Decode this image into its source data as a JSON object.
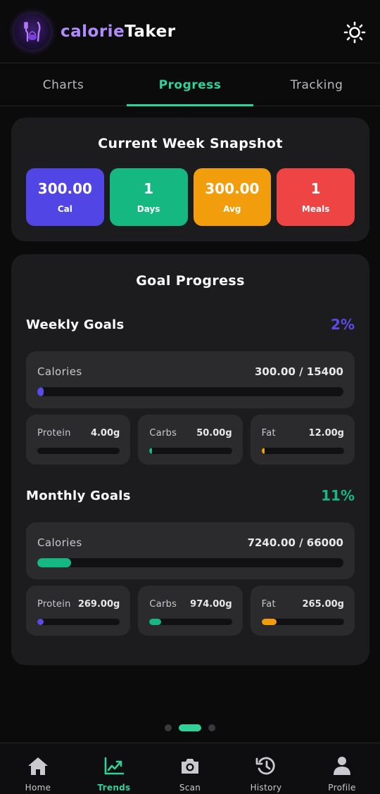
{
  "header": {
    "brand_part1": "calorie",
    "brand_part2": "Taker",
    "logo_icon": "fork-knife-logo-icon",
    "theme_icon": "sun-icon"
  },
  "tabs": [
    {
      "label": "Charts",
      "active": false
    },
    {
      "label": "Progress",
      "active": true
    },
    {
      "label": "Tracking",
      "active": false
    }
  ],
  "snapshot": {
    "title": "Current Week Snapshot",
    "stats": [
      {
        "value": "300.00",
        "label": "Cal",
        "color": "#5245e6"
      },
      {
        "value": "1",
        "label": "Days",
        "color": "#16b882"
      },
      {
        "value": "300.00",
        "label": "Avg",
        "color": "#f29e0c"
      },
      {
        "value": "1",
        "label": "Meals",
        "color": "#ee4444"
      }
    ]
  },
  "goals": {
    "title": "Goal Progress",
    "weekly": {
      "name": "Weekly Goals",
      "percent": "2%",
      "color": "#5b4be8",
      "calories_label": "Calories",
      "calories_value": "300.00 / 15400",
      "calories_progress": 0.02,
      "macros": [
        {
          "name": "Protein",
          "value": "4.00g",
          "progress": 0.0,
          "color": "#5b4be8"
        },
        {
          "name": "Carbs",
          "value": "50.00g",
          "progress": 0.01,
          "color": "#16b882"
        },
        {
          "name": "Fat",
          "value": "12.00g",
          "progress": 0.01,
          "color": "#f29e0c"
        }
      ]
    },
    "monthly": {
      "name": "Monthly Goals",
      "percent": "11%",
      "color": "#16b882",
      "calories_label": "Calories",
      "calories_value": "7240.00 / 66000",
      "calories_progress": 0.11,
      "macros": [
        {
          "name": "Protein",
          "value": "269.00g",
          "progress": 0.08,
          "color": "#5b4be8"
        },
        {
          "name": "Carbs",
          "value": "974.00g",
          "progress": 0.14,
          "color": "#16b882"
        },
        {
          "name": "Fat",
          "value": "265.00g",
          "progress": 0.18,
          "color": "#f29e0c"
        }
      ]
    }
  },
  "pager": {
    "count": 3,
    "active_index": 1
  },
  "bottom_nav": [
    {
      "label": "Home",
      "icon": "home-icon",
      "active": false
    },
    {
      "label": "Trends",
      "icon": "trend-chart-icon",
      "active": true
    },
    {
      "label": "Scan",
      "icon": "camera-icon",
      "active": false
    },
    {
      "label": "History",
      "icon": "history-icon",
      "active": false
    },
    {
      "label": "Profile",
      "icon": "person-icon",
      "active": false
    }
  ]
}
